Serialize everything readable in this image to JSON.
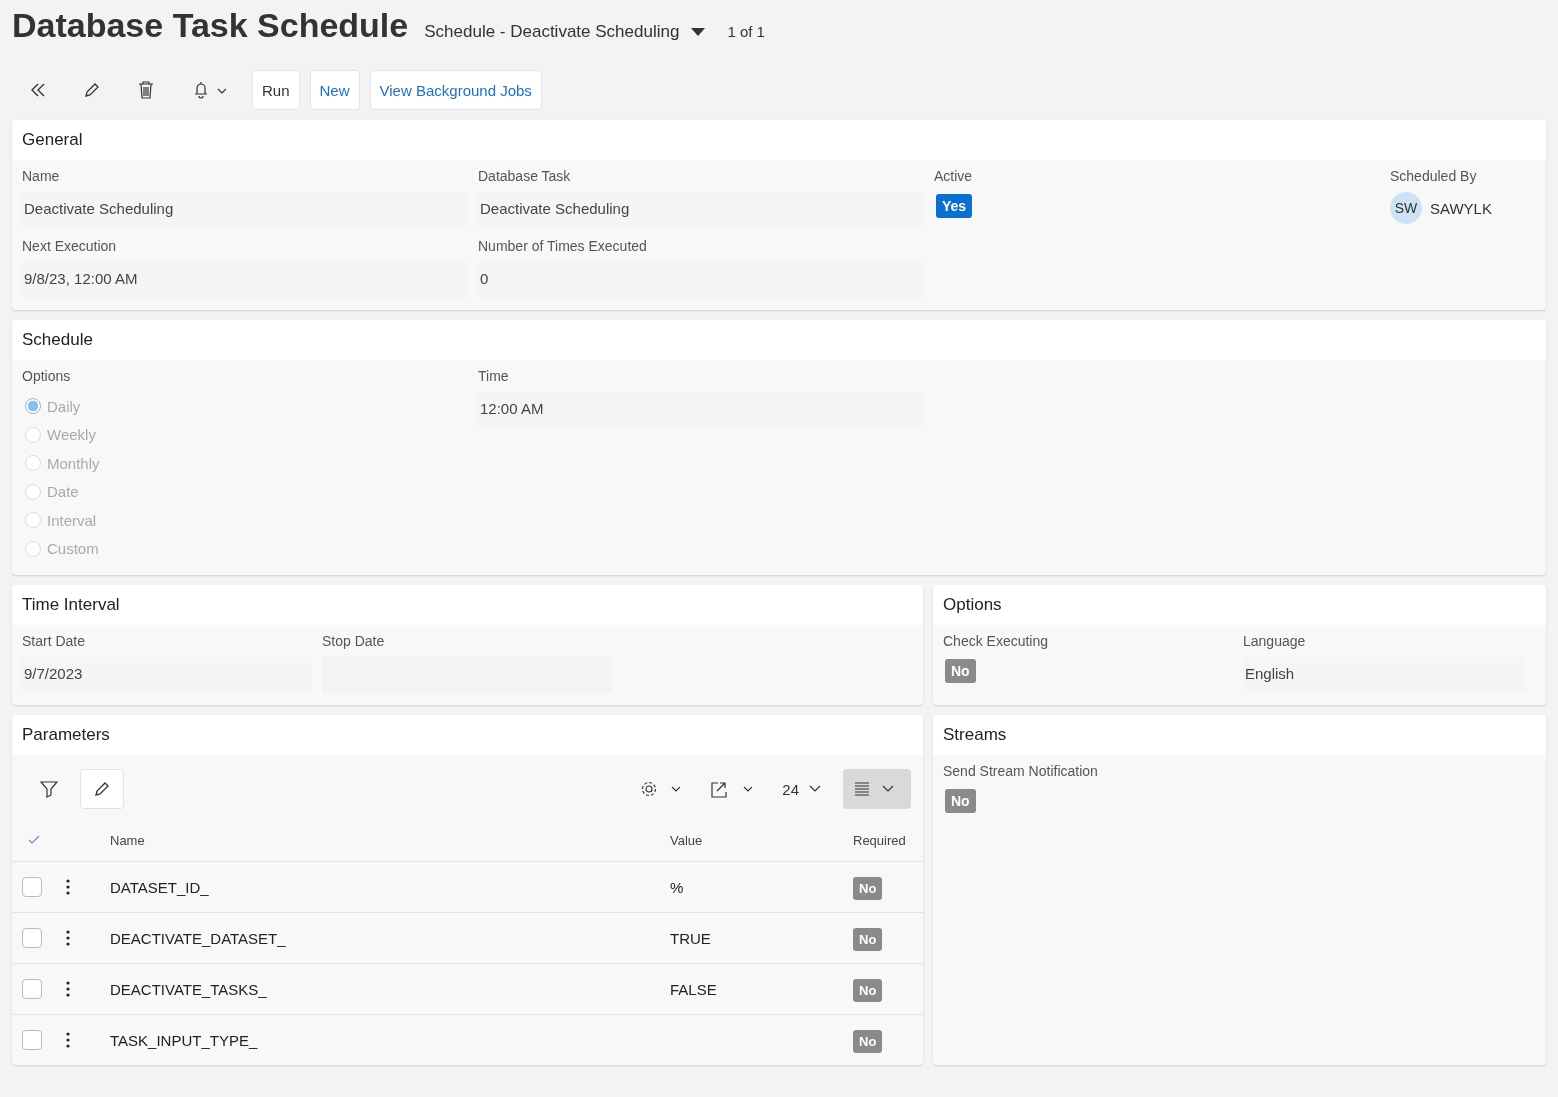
{
  "header": {
    "title": "Database Task Schedule",
    "record": "Schedule - Deactivate Scheduling",
    "pager": "1 of 1"
  },
  "toolbar": {
    "buttons": [
      {
        "label": "Run",
        "primary": false
      },
      {
        "label": "New",
        "primary": true
      },
      {
        "label": "View Background Jobs",
        "primary": true
      }
    ]
  },
  "general": {
    "title": "General",
    "fields": [
      {
        "kind": "text",
        "label": "Name",
        "value": "Deactivate Scheduling"
      },
      {
        "kind": "text",
        "label": "Database Task",
        "value": "Deactivate Scheduling"
      },
      {
        "kind": "badge",
        "label": "Active",
        "value": "Yes",
        "on": true
      },
      {
        "kind": "user",
        "label": "Scheduled By",
        "initials": "SW",
        "value": "SAWYLK"
      },
      {
        "kind": "text",
        "label": "Next Execution",
        "value": "9/8/23, 12:00 AM"
      },
      {
        "kind": "text",
        "label": "Number of Times Executed",
        "value": "0"
      }
    ]
  },
  "schedule": {
    "title": "Schedule",
    "options_label": "Options",
    "options": [
      {
        "label": "Daily",
        "selected": true
      },
      {
        "label": "Weekly",
        "selected": false
      },
      {
        "label": "Monthly",
        "selected": false
      },
      {
        "label": "Date",
        "selected": false
      },
      {
        "label": "Interval",
        "selected": false
      },
      {
        "label": "Custom",
        "selected": false
      }
    ],
    "time_label": "Time",
    "time": "12:00 AM"
  },
  "time_interval": {
    "title": "Time Interval",
    "fields": [
      {
        "kind": "text",
        "label": "Start Date",
        "value": "9/7/2023"
      },
      {
        "kind": "empty",
        "label": "Stop Date"
      }
    ]
  },
  "options": {
    "title": "Options",
    "fields": [
      {
        "kind": "badge",
        "label": "Check Executing",
        "value": "No",
        "on": false
      },
      {
        "kind": "text",
        "label": "Language",
        "value": "English"
      }
    ]
  },
  "parameters": {
    "title": "Parameters",
    "page_size": "24",
    "columns": [
      "Name",
      "Value",
      "Required"
    ],
    "rows": [
      {
        "name": "DATASET_ID_",
        "value": "%",
        "required": "No",
        "required_on": false,
        "checked": false
      },
      {
        "name": "DEACTIVATE_DATASET_",
        "value": "TRUE",
        "required": "No",
        "required_on": false,
        "checked": false
      },
      {
        "name": "DEACTIVATE_TASKS_",
        "value": "FALSE",
        "required": "No",
        "required_on": false,
        "checked": false
      },
      {
        "name": "TASK_INPUT_TYPE_",
        "required": "No",
        "required_on": false,
        "checked": false
      }
    ]
  },
  "streams": {
    "title": "Streams",
    "fields": [
      {
        "kind": "badge",
        "label": "Send Stream Notification",
        "value": "No",
        "on": false
      }
    ]
  }
}
